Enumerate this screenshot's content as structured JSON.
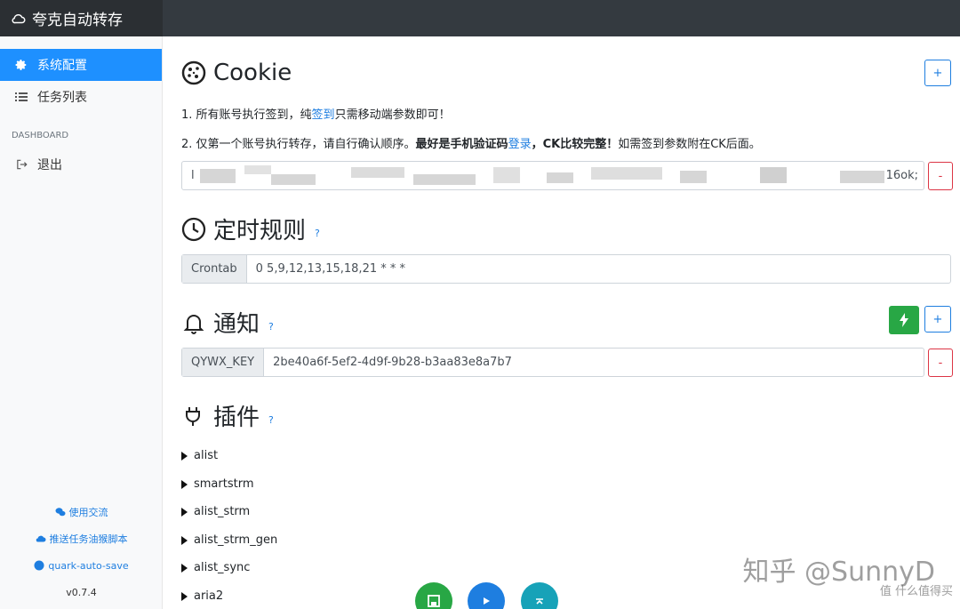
{
  "app": {
    "title": "夸克自动转存"
  },
  "sidebar": {
    "items": [
      {
        "label": "系统配置",
        "icon": "gear-icon",
        "active": true
      },
      {
        "label": "任务列表",
        "icon": "list-icon",
        "active": false
      }
    ],
    "heading": "DASHBOARD",
    "logout_label": "退出",
    "links": [
      {
        "label": "使用交流",
        "icon": "wechat-icon"
      },
      {
        "label": "推送任务油猴脚本",
        "icon": "cloud-upload-icon"
      },
      {
        "label": "quark-auto-save",
        "icon": "github-icon"
      }
    ],
    "version": "v0.7.4"
  },
  "cookie": {
    "title": "Cookie",
    "line1_pre": "1. 所有账号执行签到，纯",
    "line1_link": "签到",
    "line1_post": "只需移动端参数即可！",
    "line2_pre": "2. 仅第一个账号执行转存，请自行确认顺序。",
    "line2_bold1": "最好是手机验证码",
    "line2_link": "登录",
    "line2_bold2": "，CK比较完整！",
    "line2_post": "如需签到参数附在CK后面。",
    "value_start": "l",
    "value_end": "16ok;",
    "add_label": "+",
    "remove_label": "-"
  },
  "schedule": {
    "title": "定时规则",
    "help": "?",
    "prefix": "Crontab",
    "value": "0 5,9,12,13,15,18,21 * * *"
  },
  "notify": {
    "title": "通知",
    "help": "?",
    "prefix": "QYWX_KEY",
    "value": "2be40a6f-5ef2-4d9f-9b28-b3aa83e8a7b7",
    "add_label": "+",
    "remove_label": "-"
  },
  "plugins": {
    "title": "插件",
    "help": "?",
    "items": [
      "alist",
      "smartstrm",
      "alist_strm",
      "alist_strm_gen",
      "alist_sync",
      "aria2"
    ]
  },
  "colors": {
    "accent": "#1e90ff",
    "topbar": "#343a40",
    "success": "#28a745",
    "danger": "#dc3545",
    "fab_save": "#28a745",
    "fab_run": "#1e7ee0",
    "fab_top": "#17a2b8"
  },
  "watermark": {
    "main": "知乎 @SunnyD",
    "sub": "值 什么值得买"
  }
}
